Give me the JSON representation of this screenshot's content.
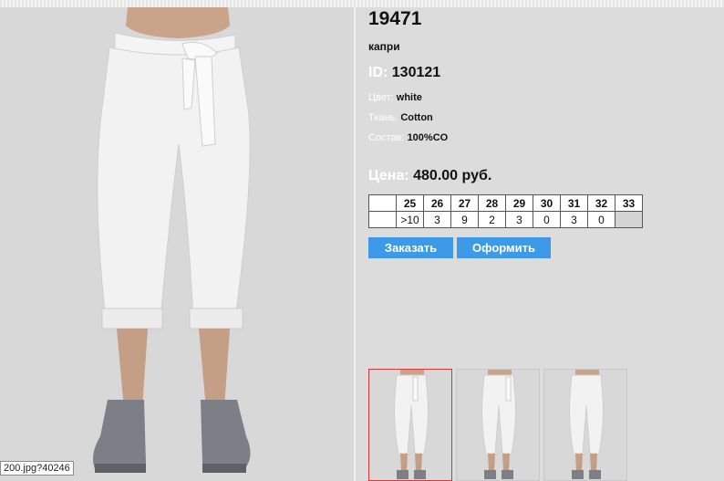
{
  "product": {
    "sku": "19471",
    "type": "капри",
    "id_label": "ID:",
    "id_value": "130121",
    "color_label": "Цвет:",
    "color_value": "white",
    "fabric_label": "Ткань:",
    "fabric_value": "Cotton",
    "composition_label": "Состав:",
    "composition_value": "100%CO",
    "price_label": "Цена:",
    "price_value": "480.00 руб."
  },
  "sizes": {
    "headers": [
      "",
      "25",
      "26",
      "27",
      "28",
      "29",
      "30",
      "31",
      "32",
      "33"
    ],
    "stock": [
      "",
      ">10",
      "3",
      "9",
      "2",
      "3",
      "0",
      "3",
      "0",
      ""
    ]
  },
  "buttons": {
    "order": "Заказать",
    "checkout": "Оформить"
  },
  "status_tip": "200.jpg?40246",
  "colors": {
    "background": "#dcdcdc",
    "button": "#3d9ae8",
    "selected_thumb_border": "#d23a3a"
  },
  "thumbnails": [
    "front-view",
    "side-view",
    "back-view"
  ]
}
